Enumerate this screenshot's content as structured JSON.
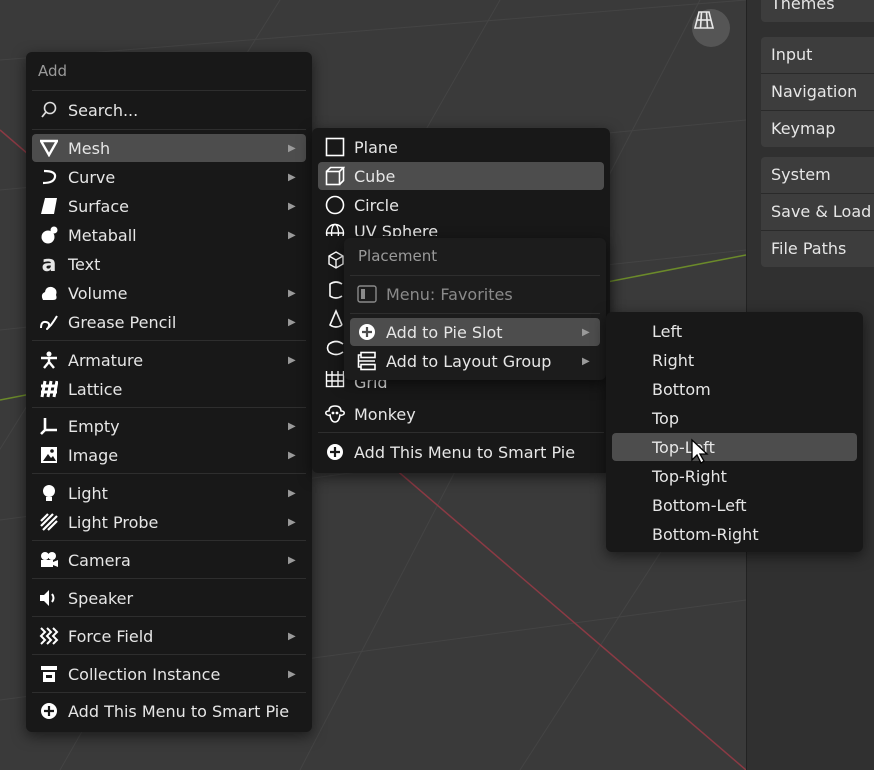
{
  "prefs": {
    "group1": [
      "Themes"
    ],
    "group2": [
      "Input",
      "Navigation",
      "Keymap"
    ],
    "group3": [
      "System",
      "Save & Load",
      "File Paths"
    ]
  },
  "add_menu": {
    "title": "Add",
    "search": "Search...",
    "items": {
      "mesh": "Mesh",
      "curve": "Curve",
      "surface": "Surface",
      "metaball": "Metaball",
      "text": "Text",
      "volume": "Volume",
      "grease_pencil": "Grease Pencil",
      "armature": "Armature",
      "lattice": "Lattice",
      "empty": "Empty",
      "image": "Image",
      "light": "Light",
      "light_probe": "Light Probe",
      "camera": "Camera",
      "speaker": "Speaker",
      "force_field": "Force Field",
      "collection_instance": "Collection Instance",
      "smart_pie": "Add This Menu to Smart Pie"
    }
  },
  "mesh_menu": {
    "plane": "Plane",
    "cube": "Cube",
    "circle": "Circle",
    "uv_sphere": "UV Sphere",
    "grid": "Grid",
    "monkey": "Monkey",
    "smart_pie": "Add This Menu to Smart Pie"
  },
  "placement_menu": {
    "title": "Placement",
    "favorites": "Menu: Favorites",
    "pie_slot": "Add to Pie Slot",
    "layout_group": "Add to Layout Group"
  },
  "slot_menu": {
    "left": "Left",
    "right": "Right",
    "bottom": "Bottom",
    "top": "Top",
    "top_left": "Top-Left",
    "top_right": "Top-Right",
    "bottom_left": "Bottom-Left",
    "bottom_right": "Bottom-Right"
  },
  "colors": {
    "menu_bg": "#181818",
    "highlight": "#4d4d4d",
    "x_axis": "#8b3a44",
    "y_axis": "#6b8a2a"
  }
}
